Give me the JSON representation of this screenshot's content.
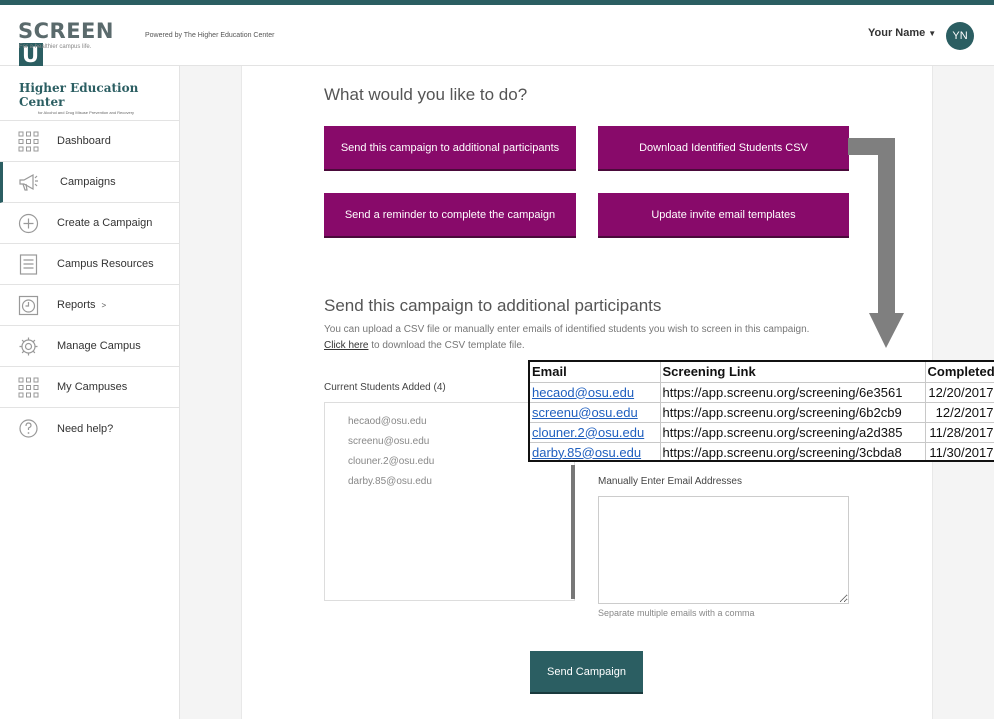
{
  "header": {
    "logo_text": "SCREEN",
    "logo_letter": "U",
    "logo_tagline": "For a healthier campus life.",
    "powered_by": "Powered by The Higher Education Center",
    "user_name": "Your Name",
    "user_initials": "YN"
  },
  "sidebar": {
    "brand_name": "Higher Education Center",
    "brand_sub": "for Alcohol and Drug Misuse Prevention and Recovery",
    "items": [
      {
        "label": "Dashboard",
        "icon": "grid-icon"
      },
      {
        "label": "Campaigns",
        "icon": "megaphone-icon",
        "active": true
      },
      {
        "label": "Create a Campaign",
        "icon": "plus-circle-icon"
      },
      {
        "label": "Campus Resources",
        "icon": "document-icon"
      },
      {
        "label": "Reports",
        "icon": "clock-icon",
        "chevron": ">"
      },
      {
        "label": "Manage Campus",
        "icon": "gear-icon"
      },
      {
        "label": "My Campuses",
        "icon": "grid-icon"
      },
      {
        "label": "Need help?",
        "icon": "question-icon"
      }
    ]
  },
  "main": {
    "prompt_heading": "What would you like to do?",
    "actions": {
      "send_additional": "Send this campaign to additional participants",
      "download_csv": "Download Identified Students CSV",
      "send_reminder": "Send a reminder to complete the campaign",
      "update_templates": "Update invite email templates"
    },
    "section_heading": "Send this campaign to additional participants",
    "description": "You can upload a CSV file or manually enter emails of identified students you wish to screen in this campaign.",
    "click_here": "Click here",
    "description_suffix": " to download the CSV template file.",
    "current_students_label": "Current Students Added (4)",
    "current_students": [
      "hecaod@osu.edu",
      "screenu@osu.edu",
      "clouner.2@osu.edu",
      "darby.85@osu.edu"
    ],
    "manual_label": "Manually Enter Email Addresses",
    "manual_value": "",
    "manual_help": "Separate multiple emails with a comma",
    "send_button": "Send Campaign"
  },
  "csv_preview": {
    "headers": [
      "Email",
      "Screening Link",
      "Completed"
    ],
    "rows": [
      [
        "hecaod@osu.edu",
        "https://app.screenu.org/screening/6e3561",
        "12/20/2017"
      ],
      [
        "screenu@osu.edu",
        "https://app.screenu.org/screening/6b2cb9",
        "12/2/2017"
      ],
      [
        "clouner.2@osu.edu",
        "https://app.screenu.org/screening/a2d385",
        "11/28/2017"
      ],
      [
        "darby.85@osu.edu",
        "https://app.screenu.org/screening/3cbda8",
        "11/30/2017"
      ]
    ]
  },
  "colors": {
    "brand_teal": "#2b5e62",
    "action_purple": "#880a6a",
    "link_blue": "#1f5fbf"
  }
}
